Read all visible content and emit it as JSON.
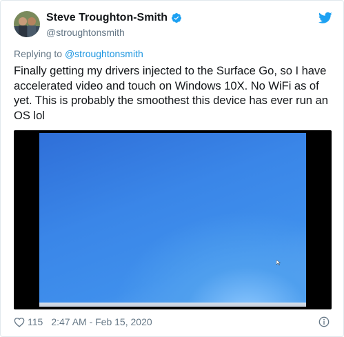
{
  "tweet": {
    "author_name": "Steve Troughton-Smith",
    "author_handle": "@stroughtonsmith",
    "replying_prefix": "Replying to ",
    "replying_to": "@stroughtonsmith",
    "text": "Finally getting my drivers injected to the Surface Go, so I have accelerated video and touch on Windows 10X. No WiFi as of yet. This is probably the smoothest this device has ever run an OS lol",
    "like_count": "115",
    "timestamp": "2:47 AM - Feb 15, 2020"
  },
  "icons": {
    "avatar": "avatar",
    "verified": "verified-badge-icon",
    "brand": "twitter-bird-icon",
    "like": "heart-icon",
    "info": "info-icon"
  },
  "colors": {
    "brand_blue": "#1da1f2",
    "link_blue": "#1b95e0",
    "secondary_text": "#657786",
    "primary_text": "#14171a"
  }
}
